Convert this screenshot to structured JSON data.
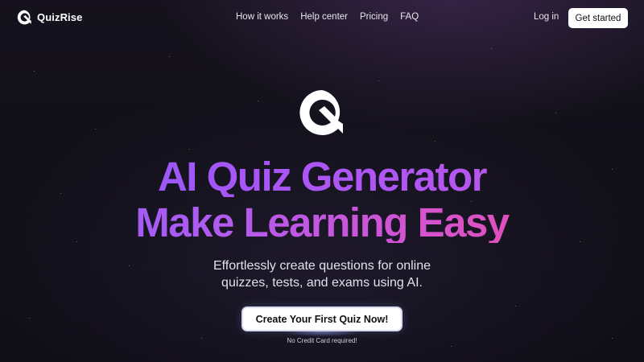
{
  "brand": {
    "name": "QuizRise",
    "icon": "quizrise-logo-icon"
  },
  "nav": {
    "links": [
      {
        "label": "How it works"
      },
      {
        "label": "Help center"
      },
      {
        "label": "Pricing"
      },
      {
        "label": "FAQ"
      }
    ],
    "login_label": "Log in",
    "get_started_label": "Get started"
  },
  "hero": {
    "logo_icon": "quizrise-logo-icon",
    "headline_line1": "AI Quiz Generator",
    "headline_line2": "Make Learning Easy",
    "subtitle_line1": "Effortlessly create questions for online",
    "subtitle_line2": "quizzes, tests, and exams using AI.",
    "cta_label": "Create Your First Quiz Now!",
    "cta_note": "No Credit Card required!"
  },
  "colors": {
    "background": "#121019",
    "gradient_start": "#8b5cf6",
    "gradient_mid": "#c058e8",
    "gradient_end": "#ec4c9d",
    "button_bg": "#ffffff"
  }
}
